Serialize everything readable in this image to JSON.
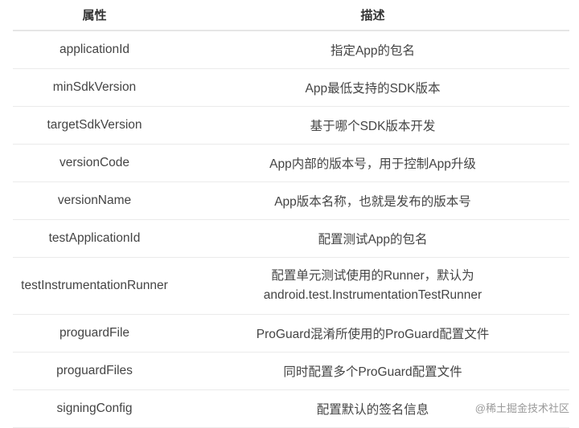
{
  "header": {
    "col_attribute": "属性",
    "col_description": "描述"
  },
  "rows": [
    {
      "attr": "applicationId",
      "desc": "指定App的包名"
    },
    {
      "attr": "minSdkVersion",
      "desc": "App最低支持的SDK版本"
    },
    {
      "attr": "targetSdkVersion",
      "desc": "基于哪个SDK版本开发"
    },
    {
      "attr": "versionCode",
      "desc": "App内部的版本号，用于控制App升级"
    },
    {
      "attr": "versionName",
      "desc": "App版本名称，也就是发布的版本号"
    },
    {
      "attr": "testApplicationId",
      "desc": "配置测试App的包名"
    },
    {
      "attr": "testInstrumentationRunner",
      "desc_line1": "配置单元测试使用的Runner，默认为",
      "desc_line2": "android.test.InstrumentationTestRunner"
    },
    {
      "attr": "proguardFile",
      "desc": "ProGuard混淆所使用的ProGuard配置文件"
    },
    {
      "attr": "proguardFiles",
      "desc": "同时配置多个ProGuard配置文件"
    },
    {
      "attr": "signingConfig",
      "desc": "配置默认的签名信息"
    }
  ],
  "watermark": "@稀土掘金技术社区"
}
